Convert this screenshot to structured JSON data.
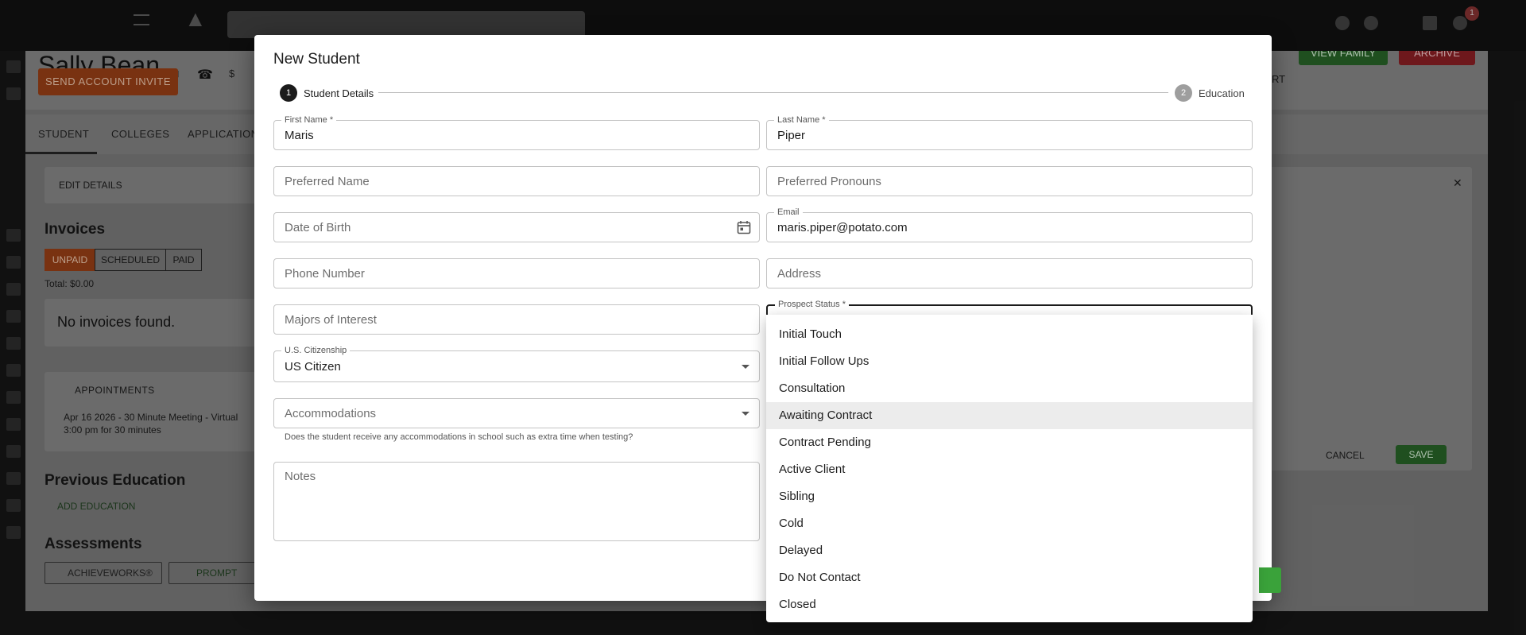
{
  "background": {
    "student_name": "Sally Bean",
    "status_text": "$",
    "send_invite_label": "SEND ACCOUNT INVITE",
    "report_label": "RT",
    "view_family_label": "VIEW FAMILY",
    "archive_label": "ARCHIVE",
    "tabs": [
      "STUDENT",
      "COLLEGES",
      "APPLICATION"
    ],
    "edit_details_label": "EDIT DETAILS",
    "invoices_heading": "Invoices",
    "invoice_filters": [
      "UNPAID",
      "SCHEDULED",
      "PAID"
    ],
    "invoice_total": "Total: $0.00",
    "no_invoices": "No invoices found.",
    "appointments_label": "APPOINTMENTS",
    "appointment_title": "Apr 16 2026 - 30 Minute Meeting - Virtual",
    "appointment_time": "3:00 pm for 30 minutes",
    "previous_education_heading": "Previous Education",
    "add_education_label": "ADD EDUCATION",
    "assessments_heading": "Assessments",
    "assessment_chips": [
      "ACHIEVEWORKS®",
      "PROMPT"
    ],
    "right_panel_cancel": "CANCEL",
    "right_panel_save": "SAVE",
    "notification_count": "1"
  },
  "modal": {
    "title": "New Student",
    "steps": [
      {
        "number": "1",
        "label": "Student Details"
      },
      {
        "number": "2",
        "label": "Education"
      }
    ],
    "fields": {
      "first_name": {
        "label": "First Name *",
        "value": "Maris"
      },
      "last_name": {
        "label": "Last Name *",
        "value": "Piper"
      },
      "preferred_name": {
        "placeholder": "Preferred Name"
      },
      "preferred_pronouns": {
        "placeholder": "Preferred Pronouns"
      },
      "date_of_birth": {
        "placeholder": "Date of Birth"
      },
      "email": {
        "label": "Email",
        "value": "maris.piper@potato.com"
      },
      "phone_number": {
        "placeholder": "Phone Number"
      },
      "address": {
        "placeholder": "Address"
      },
      "majors_of_interest": {
        "placeholder": "Majors of Interest"
      },
      "prospect_status": {
        "label": "Prospect Status *"
      },
      "us_citizenship": {
        "label": "U.S. Citizenship",
        "value": "US Citizen"
      },
      "accommodations": {
        "placeholder": "Accommodations",
        "helper": "Does the student receive any accommodations in school such as extra time when testing?"
      },
      "notes": {
        "placeholder": "Notes"
      }
    }
  },
  "prospect_status_menu": {
    "options": [
      "Initial Touch",
      "Initial Follow Ups",
      "Consultation",
      "Awaiting Contract",
      "Contract Pending",
      "Active Client",
      "Sibling",
      "Cold",
      "Delayed",
      "Do Not Contact",
      "Closed"
    ],
    "highlighted": "Awaiting Contract"
  },
  "colors": {
    "primary_dark": "#1b1b1b",
    "step_inactive": "#9e9e9e",
    "accent_orange": "#c2541e",
    "accent_green": "#2e8b2e",
    "accent_red": "#b0282e"
  }
}
